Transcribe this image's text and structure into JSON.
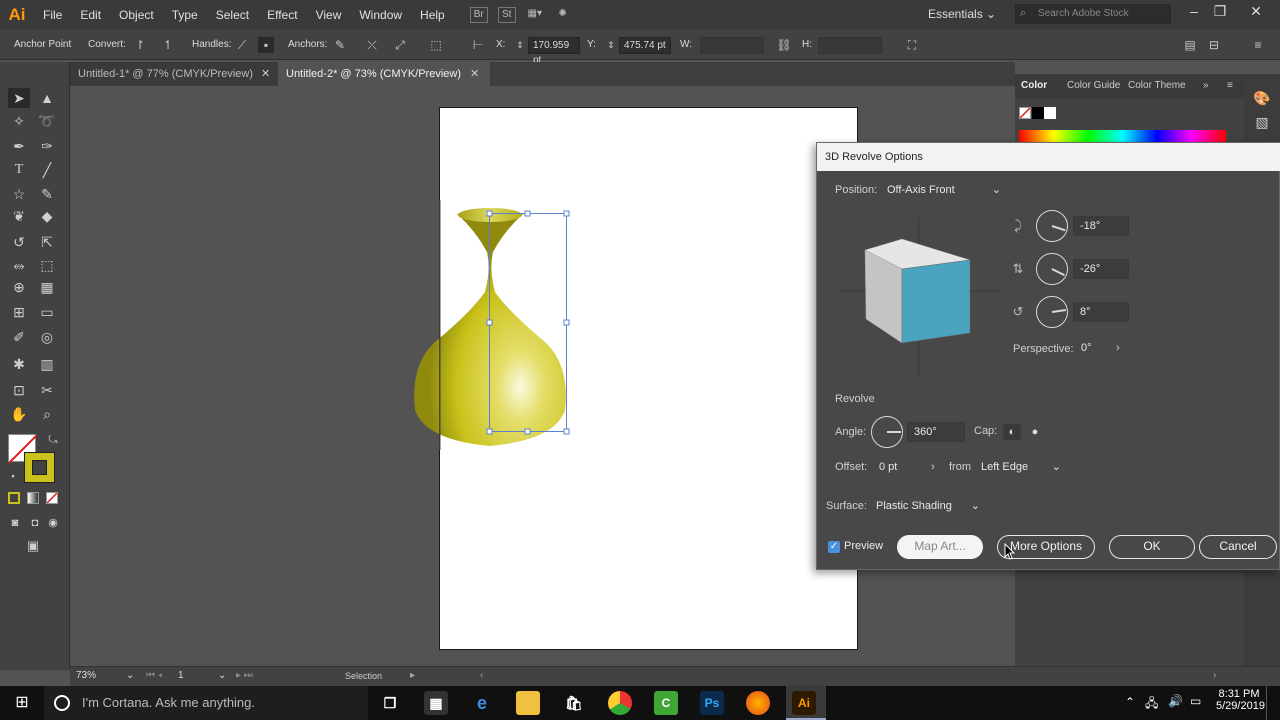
{
  "app": {
    "logo": "Ai"
  },
  "menu": [
    "File",
    "Edit",
    "Object",
    "Type",
    "Select",
    "Effect",
    "View",
    "Window",
    "Help"
  ],
  "menu_icons": [
    "Br",
    "St"
  ],
  "workspace": "Essentials",
  "stock_search_placeholder": "Search Adobe Stock",
  "control_bar": {
    "anchor_point": "Anchor Point",
    "convert": "Convert:",
    "handles": "Handles:",
    "anchors": "Anchors:",
    "x_label": "X:",
    "x_value": "170.959 pt",
    "y_label": "Y:",
    "y_value": "475.74 pt",
    "w_label": "W:",
    "h_label": "H:"
  },
  "tabs": [
    {
      "label": "Untitled-1* @ 77% (CMYK/Preview)",
      "active": false
    },
    {
      "label": "Untitled-2* @ 73% (CMYK/Preview)",
      "active": true
    }
  ],
  "color_panel": {
    "tabs": [
      "Color",
      "Color Guide",
      "Color Theme"
    ]
  },
  "status_bar": {
    "zoom": "73%",
    "artboard": "1",
    "tool": "Selection"
  },
  "dialog": {
    "title": "3D Revolve Options",
    "position_label": "Position:",
    "position_value": "Off-Axis Front",
    "rot_x": "-18°",
    "rot_y": "-26°",
    "rot_z": "8°",
    "perspective_label": "Perspective:",
    "perspective_value": "0°",
    "revolve_heading": "Revolve",
    "angle_label": "Angle:",
    "angle_value": "360°",
    "cap_label": "Cap:",
    "offset_label": "Offset:",
    "offset_value": "0 pt",
    "from_label": "from",
    "from_value": "Left Edge",
    "surface_label": "Surface:",
    "surface_value": "Plastic Shading",
    "preview_label": "Preview",
    "preview_checked": true,
    "map_art": "Map Art...",
    "more_options": "More Options",
    "ok": "OK",
    "cancel": "Cancel"
  },
  "colors": {
    "accent": "#4a8fe0",
    "vase": "#c9c21a",
    "cube_front": "#4aa3bf",
    "cube_top": "#e6e6e6",
    "cube_side": "#c4c4c4"
  },
  "taskbar": {
    "cortana": "I'm Cortana. Ask me anything.",
    "apps": [
      "task-view",
      "calculator",
      "edge",
      "file-explorer",
      "store",
      "chrome",
      "camtasia",
      "photoshop",
      "firefox",
      "illustrator"
    ],
    "ps_label": "Ps",
    "ai_label": "Ai",
    "time": "8:31 PM",
    "date": "5/29/2019"
  }
}
